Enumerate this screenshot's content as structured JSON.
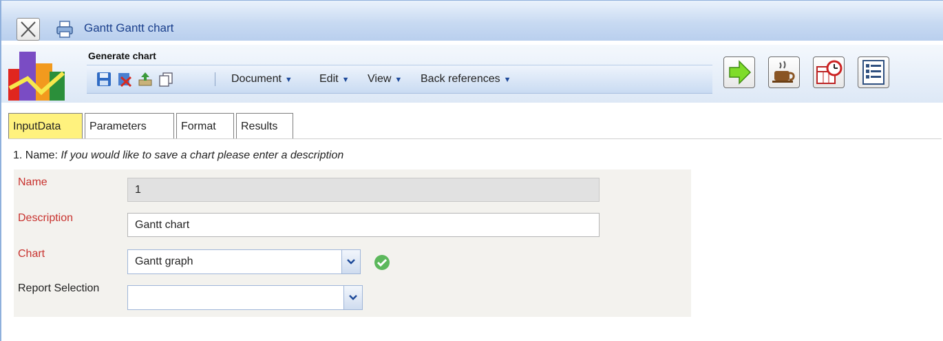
{
  "window": {
    "title": "Gantt Gantt chart",
    "close_icon": "close-icon",
    "print_icon": "printer-icon"
  },
  "toolbar": {
    "heading": "Generate chart",
    "icons": [
      "save-icon",
      "delete-icon",
      "upload-icon",
      "copy-icon"
    ],
    "menus": [
      "Document",
      "Edit",
      "View",
      "Back references"
    ],
    "action_buttons": [
      "run-arrow-icon",
      "coffee-cup-icon",
      "calendar-clock-icon",
      "list-report-icon"
    ]
  },
  "tabs": [
    {
      "label": "InputData",
      "active": true
    },
    {
      "label": "Parameters",
      "active": false
    },
    {
      "label": "Format",
      "active": false
    },
    {
      "label": "Results",
      "active": false
    }
  ],
  "intro": {
    "prefix": "1. Name: ",
    "hint": "If you would like to save a chart please enter a description"
  },
  "form": {
    "name": {
      "label": "Name",
      "value": "1"
    },
    "description": {
      "label": "Description",
      "value": "Gantt chart"
    },
    "chart": {
      "label": "Chart",
      "value": "Gantt graph"
    },
    "report_selection": {
      "label": "Report Selection",
      "value": ""
    }
  },
  "colors": {
    "active_tab": "#fff27e",
    "required_label": "#c8322e",
    "title_text": "#1a3f8c"
  }
}
